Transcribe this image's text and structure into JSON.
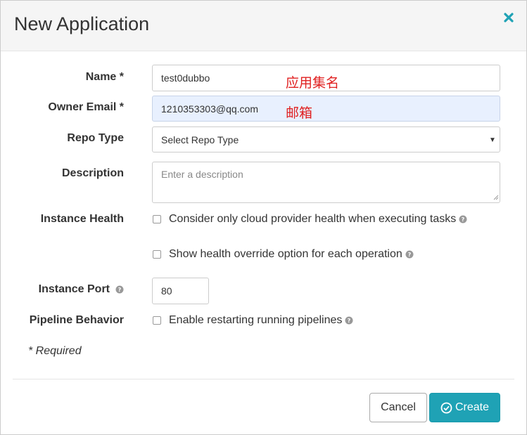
{
  "dialog": {
    "title": "New Application",
    "close_label": "close"
  },
  "form": {
    "name": {
      "label": "Name *",
      "value": "test0dubbo",
      "annotation": "应用集名"
    },
    "owner_email": {
      "label": "Owner Email *",
      "value": "1210353303@qq.com",
      "annotation": "邮箱"
    },
    "repo_type": {
      "label": "Repo Type",
      "selected": "Select Repo Type"
    },
    "description": {
      "label": "Description",
      "placeholder": "Enter a description"
    },
    "instance_health": {
      "label": "Instance Health",
      "options": [
        {
          "label": "Consider only cloud provider health when executing tasks",
          "checked": false
        },
        {
          "label": "Show health override option for each operation",
          "checked": false
        }
      ]
    },
    "instance_port": {
      "label": "Instance Port",
      "value": "80"
    },
    "pipeline_behavior": {
      "label": "Pipeline Behavior",
      "option": {
        "label": "Enable restarting running pipelines",
        "checked": false
      }
    },
    "required_note": "* Required"
  },
  "footer": {
    "cancel_label": "Cancel",
    "create_label": "Create"
  },
  "colors": {
    "primary": "#1fa2b5",
    "close_icon": "#1fa2b5",
    "annotation": "#e02020",
    "highlight_input": "#e8f0fe"
  },
  "icons": {
    "close": "close-icon",
    "help": "help-circle-icon",
    "check_circle": "check-circle-icon",
    "caret": "caret-down-icon"
  }
}
